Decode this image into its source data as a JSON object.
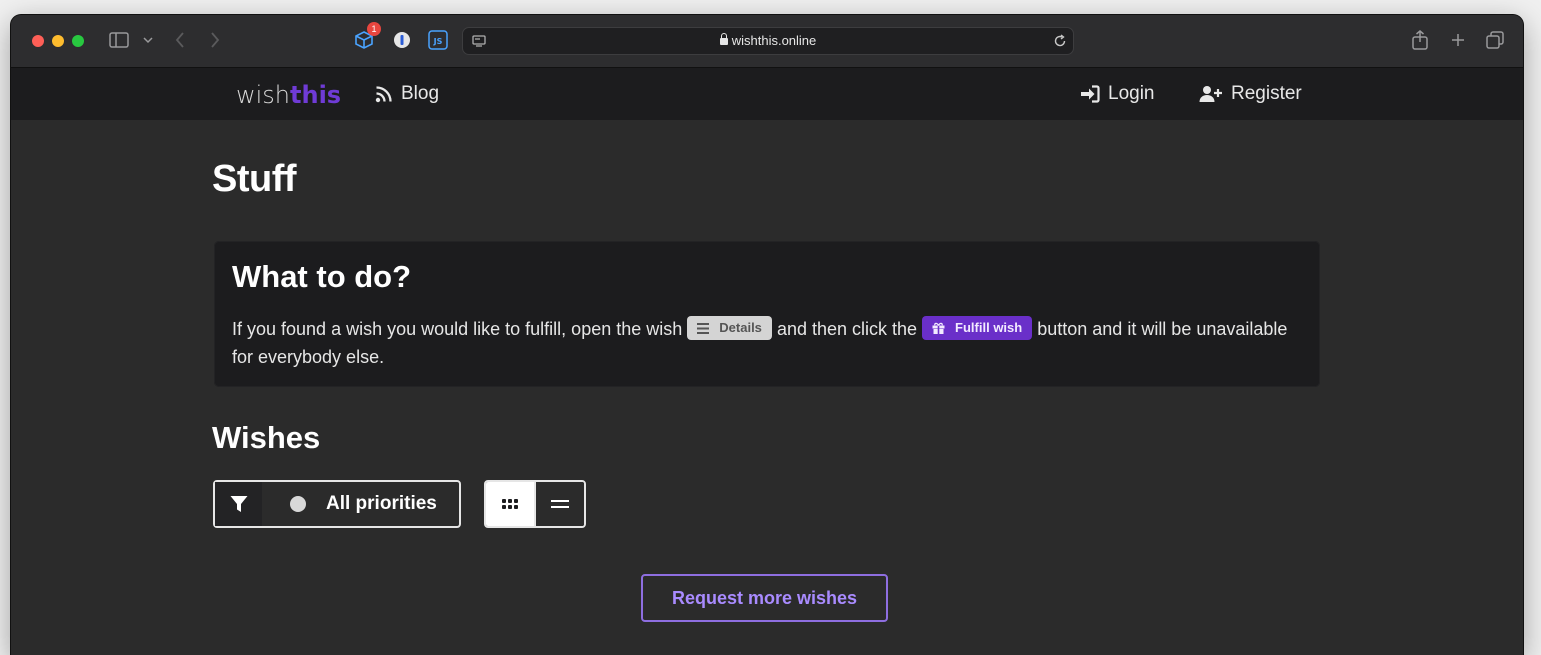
{
  "browser": {
    "url": "wishthis.online",
    "extension_badge": "1",
    "extensions": [
      "cube-extension-icon",
      "password-manager-icon",
      "js-extension-icon"
    ]
  },
  "nav": {
    "logo_prefix": "wish",
    "logo_suffix": "this",
    "blog": "Blog",
    "login": "Login",
    "register": "Register"
  },
  "page": {
    "title": "Stuff",
    "info_title": "What to do?",
    "info_text_1": "If you found a wish you would like to fulfill, open the wish",
    "details_chip": "Details",
    "info_text_2": "and then click the",
    "fulfill_chip": "Fulfill wish",
    "info_text_3": "button and it will be unavailable for everybody else.",
    "wishes_title": "Wishes",
    "filter_label": "All priorities",
    "request_button": "Request more wishes"
  },
  "colors": {
    "brand_purple": "#6a2fc9",
    "accent_button": "#a98bff",
    "background": "#2b2b2b"
  }
}
